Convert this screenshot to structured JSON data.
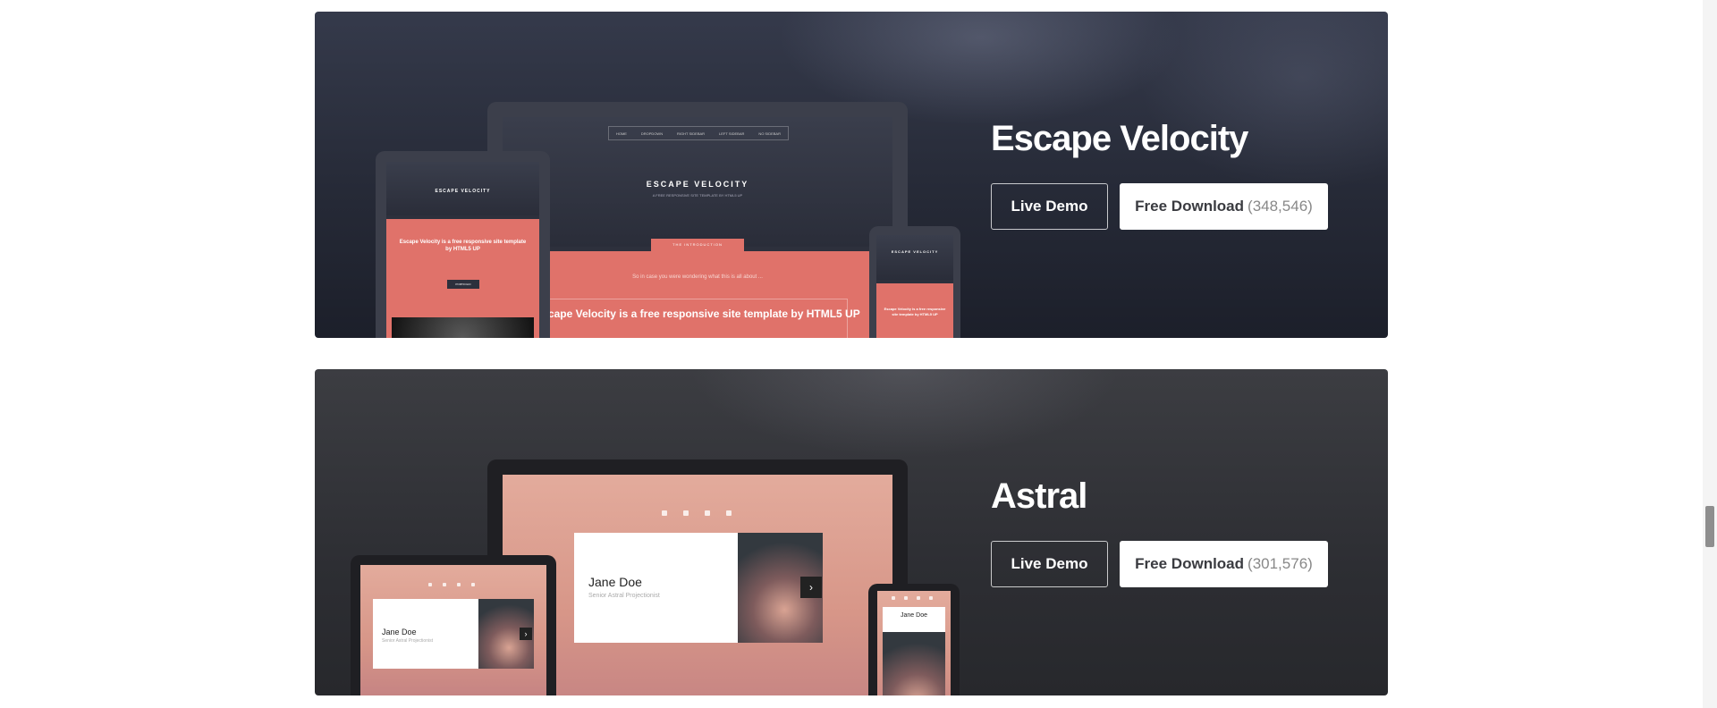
{
  "templates": [
    {
      "id": "escape-velocity",
      "title": "Escape Velocity",
      "live_demo_label": "Live Demo",
      "download_label": "Free Download",
      "download_count": "(348,546)",
      "mockup": {
        "site_title": "ESCAPE VELOCITY",
        "tagline": "A FREE RESPONSIVE SITE TEMPLATE BY HTML5 UP",
        "nav": [
          "HOME",
          "DROPDOWN",
          "RIGHT SIDEBAR",
          "LEFT SIDEBAR",
          "NO SIDEBAR"
        ],
        "intro_tab": "THE INTRODUCTION",
        "intro_text": "So in case you were wondering what this is all about ...",
        "headline": "Escape Velocity is a free responsive site template by HTML5 UP",
        "tablet_headline": "Escape Velocity is a free responsive site template by HTML5 UP",
        "phone_headline": "Escape Velocity is a free responsive site template by HTML5 UP",
        "button": "PORTFOLIO"
      }
    },
    {
      "id": "astral",
      "title": "Astral",
      "live_demo_label": "Live Demo",
      "download_label": "Free Download",
      "download_count": "(301,576)",
      "mockup": {
        "name": "Jane Doe",
        "role": "Senior Astral Projectionist"
      }
    }
  ],
  "colors": {
    "ev_accent": "#e0726a",
    "astral_pink": "#e3ab9c"
  },
  "icons": [
    "home-icon",
    "folder-icon",
    "envelope-icon",
    "twitter-icon",
    "chevron-right-icon"
  ]
}
